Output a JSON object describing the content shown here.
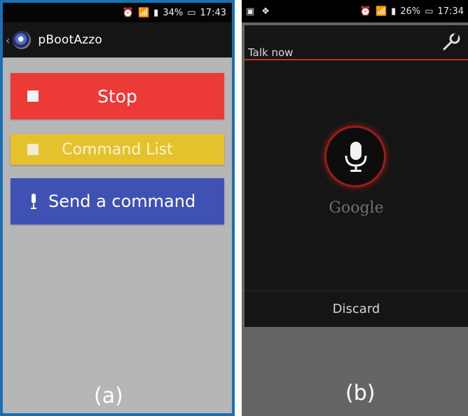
{
  "panel_a": {
    "status_bar": {
      "battery": "34%",
      "time": "17:43"
    },
    "app_title": "pBootAzzo",
    "buttons": {
      "stop": "Stop",
      "command_list": "Command List",
      "send_command": "Send a command"
    },
    "caption": "(a)"
  },
  "panel_b": {
    "status_bar": {
      "battery": "26%",
      "time": "17:34"
    },
    "prompt": "Talk now",
    "brand": "Google",
    "discard_label": "Discard",
    "caption": "(b)",
    "icons": [
      "picture-icon",
      "dropbox-icon",
      "settings-icon",
      "wrench-icon",
      "microphone-icon"
    ]
  },
  "colors": {
    "stop": "#ec3a37",
    "command_list": "#e5c12e",
    "send_command": "#3f52b3",
    "voice_ring": "#9b1d1a"
  }
}
